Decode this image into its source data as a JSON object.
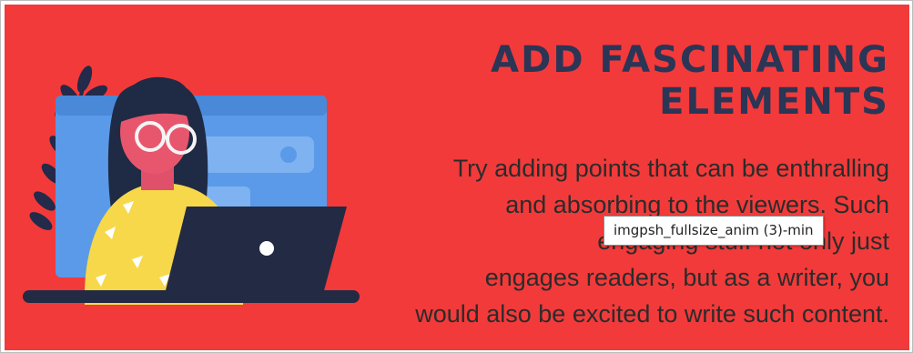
{
  "banner": {
    "background": "#f23a3a",
    "title_lines": [
      "ADD FASCINATING",
      "ELEMENTS"
    ],
    "title_color": "#2b3556",
    "body_lines": [
      "Try adding points that can be enthralling",
      "and absorbing to the viewers. Such",
      "engaging stuff not only just",
      "engages readers, but as a writer, you",
      "would also be excited to write such content."
    ]
  },
  "illustration": {
    "icons": [
      "woman-with-laptop-illustration",
      "leaf-branch-icon",
      "browser-window-icon",
      "smiley-icon"
    ]
  },
  "tooltip": {
    "text": "imgpsh_fullsize_anim (3)-min"
  }
}
